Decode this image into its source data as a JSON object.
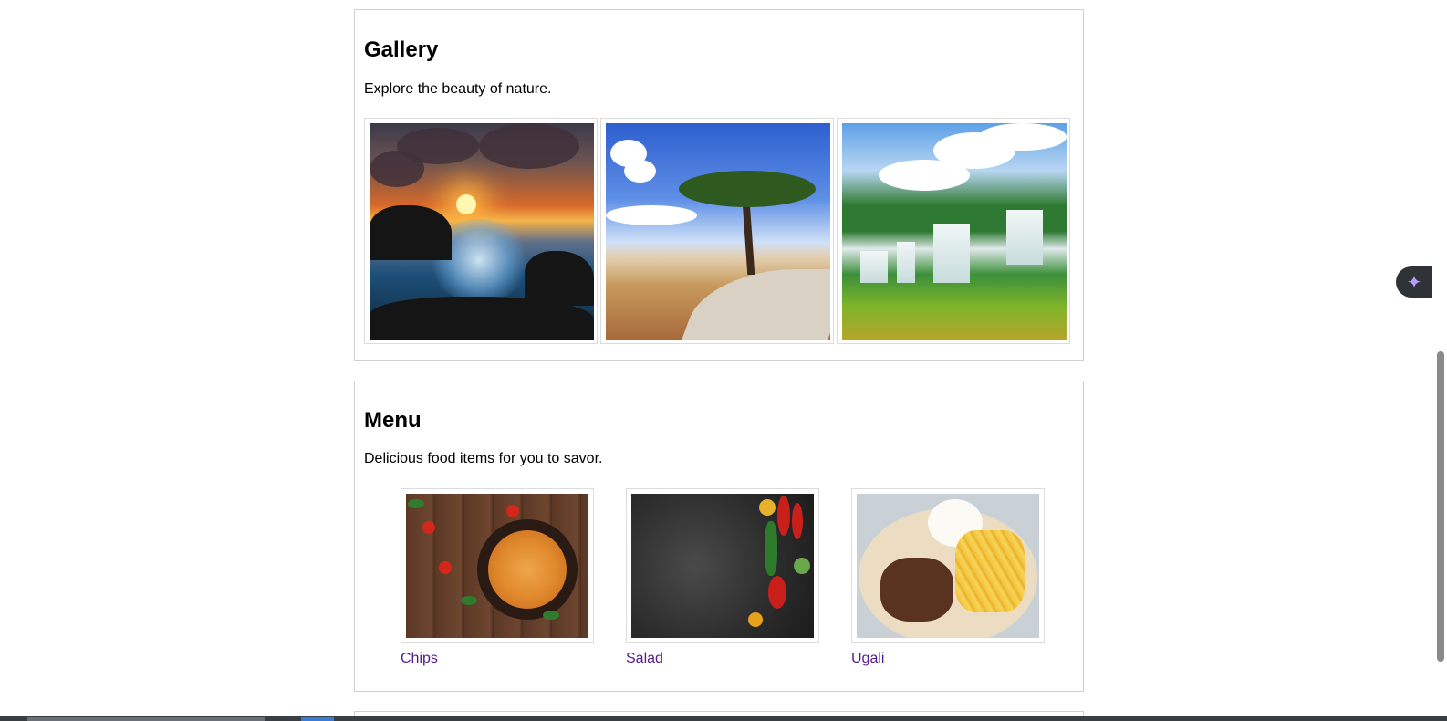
{
  "gallery": {
    "title": "Gallery",
    "description": "Explore the beauty of nature.",
    "images": [
      {
        "subject": "sunset-waves-on-rocks"
      },
      {
        "subject": "acacia-tree-dirt-road"
      },
      {
        "subject": "tropical-waterfall"
      }
    ]
  },
  "menu": {
    "title": "Menu",
    "description": "Delicious food items for you to savor.",
    "items": [
      {
        "label": "Chips",
        "subject": "pasta-dish"
      },
      {
        "label": "Salad",
        "subject": "vegetables-on-slate"
      },
      {
        "label": "Ugali",
        "subject": "rice-meat-fries-plate"
      }
    ]
  },
  "floating_button": {
    "icon": "sparkle-icon",
    "glyph": "✦"
  },
  "colors": {
    "link": "#551a8b",
    "border": "#cfcfcf",
    "accent": "#b79cff"
  }
}
